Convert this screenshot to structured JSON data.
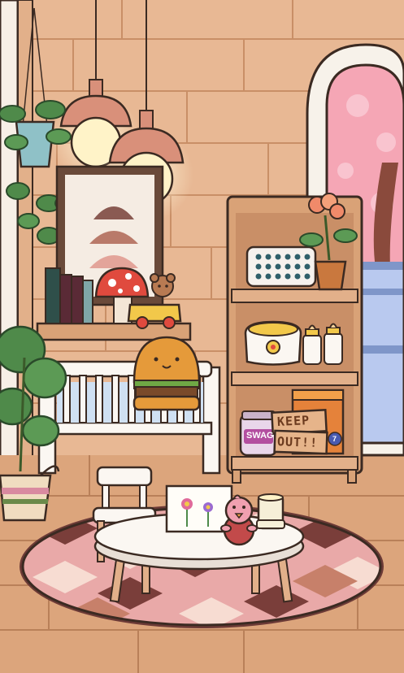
{
  "scene": {
    "name": "Nursery room",
    "sign": {
      "line1": "KEEP",
      "line2": "OUT!!"
    },
    "jar_label": "SWAG",
    "box_badge": "7"
  },
  "colors": {
    "wall": "#e8b894",
    "wall_line": "#c98f67",
    "floor": "#dca57c",
    "outline": "#3b2a22",
    "shelf_wood": "#d9a277",
    "rug_pink": "#e9a9a8",
    "rug_dark": "#7a3e3a",
    "window_pink": "#f5a6b5",
    "lamp_shade": "#d9907a"
  }
}
